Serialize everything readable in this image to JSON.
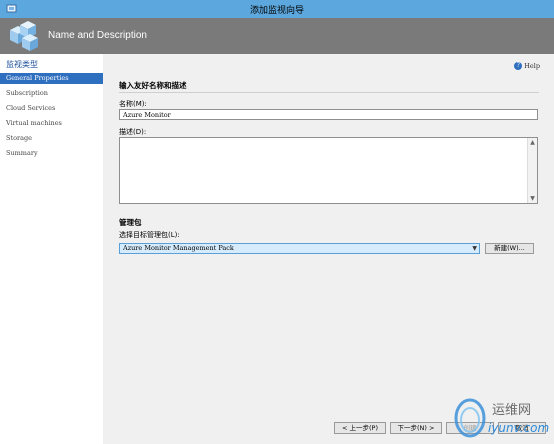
{
  "window": {
    "title": "添加监视向导"
  },
  "banner": {
    "heading": "Name and Description"
  },
  "sidebar": {
    "title": "监视类型",
    "items": [
      {
        "label": "General Properties",
        "active": true
      },
      {
        "label": "Subscription"
      },
      {
        "label": "Cloud Services"
      },
      {
        "label": "Virtual machines"
      },
      {
        "label": "Storage"
      },
      {
        "label": "Summary"
      }
    ]
  },
  "main": {
    "help_label": "Help",
    "section1_title": "输入友好名称和描述",
    "name_label": "名称(M):",
    "name_value": "Azure Monitor",
    "description_label": "描述(D):",
    "description_value": "",
    "section2_title": "管理包",
    "pack_label": "选择目标管理包(L):",
    "pack_value": "Azure Monitor Management Pack",
    "new_button": "新建(W)..."
  },
  "footer": {
    "prev_button": "< 上一步(P)",
    "next_button": "下一步(N) >",
    "create_button": "创建",
    "cancel_button": "取消"
  },
  "watermark": {
    "text": "运维网",
    "subtext": "iyunv.com"
  }
}
